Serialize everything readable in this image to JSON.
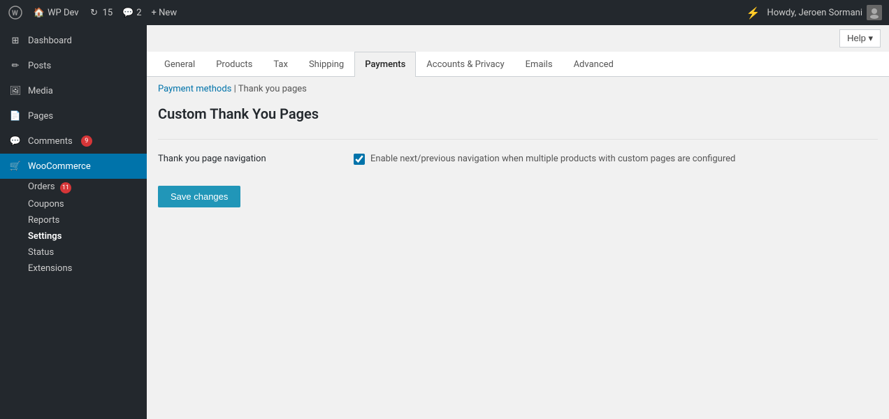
{
  "adminbar": {
    "logo_title": "WordPress",
    "site_name": "WP Dev",
    "updates_count": "15",
    "comments_count": "2",
    "new_label": "+ New",
    "lightning_icon": "⚡",
    "user_greeting": "Howdy, Jeroen Sormani",
    "help_label": "Help ▾"
  },
  "sidebar": {
    "items": [
      {
        "id": "dashboard",
        "label": "Dashboard",
        "icon": "⊞"
      },
      {
        "id": "posts",
        "label": "Posts",
        "icon": "✏"
      },
      {
        "id": "media",
        "label": "Media",
        "icon": "🖼"
      },
      {
        "id": "pages",
        "label": "Pages",
        "icon": "📄"
      },
      {
        "id": "comments",
        "label": "Comments",
        "icon": "💬",
        "badge": "9"
      },
      {
        "id": "woocommerce",
        "label": "WooCommerce",
        "icon": "🛒",
        "active": true
      }
    ],
    "sub_items": [
      {
        "id": "orders",
        "label": "Orders",
        "badge": "11"
      },
      {
        "id": "coupons",
        "label": "Coupons"
      },
      {
        "id": "reports",
        "label": "Reports"
      },
      {
        "id": "settings",
        "label": "Settings",
        "active": true
      },
      {
        "id": "status",
        "label": "Status"
      },
      {
        "id": "extensions",
        "label": "Extensions"
      }
    ]
  },
  "tabs": [
    {
      "id": "general",
      "label": "General"
    },
    {
      "id": "products",
      "label": "Products"
    },
    {
      "id": "tax",
      "label": "Tax"
    },
    {
      "id": "shipping",
      "label": "Shipping"
    },
    {
      "id": "payments",
      "label": "Payments",
      "active": true
    },
    {
      "id": "accounts-privacy",
      "label": "Accounts & Privacy"
    },
    {
      "id": "emails",
      "label": "Emails"
    },
    {
      "id": "advanced",
      "label": "Advanced"
    }
  ],
  "breadcrumb": {
    "parent_label": "Payment methods",
    "separator": "|",
    "current_label": "Thank you pages"
  },
  "page": {
    "title": "Custom Thank You Pages",
    "settings": {
      "nav_label": "Thank you page navigation",
      "nav_checkbox_id": "thankyou_nav",
      "nav_description": "Enable next/previous navigation when multiple products with custom pages are configured"
    },
    "save_button": "Save changes"
  }
}
